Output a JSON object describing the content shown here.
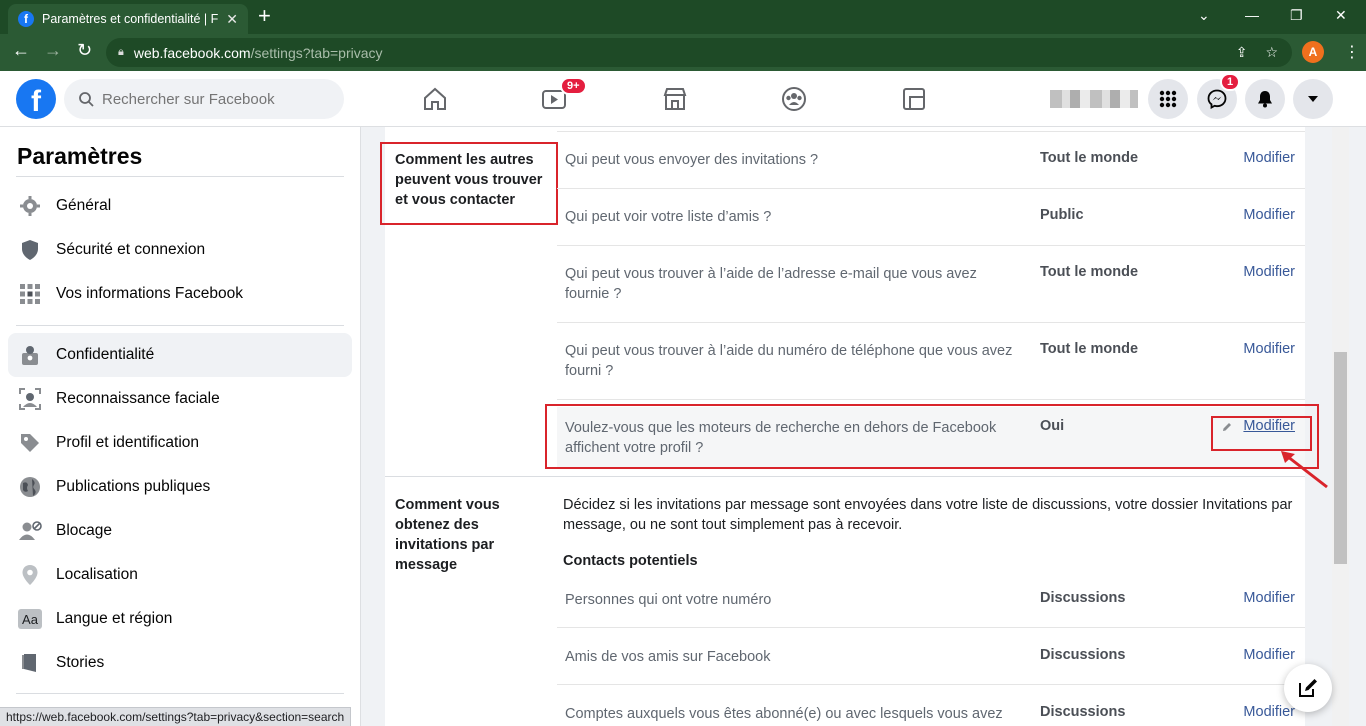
{
  "browser": {
    "tab_title": "Paramètres et confidentialité | Fa",
    "url_host": "web.facebook.com",
    "url_path": "/settings?tab=privacy",
    "profile_initial": "A",
    "status_url": "https://web.facebook.com/settings?tab=privacy&section=search"
  },
  "fb": {
    "logo": "f",
    "search_placeholder": "Rechercher sur Facebook",
    "watch_badge": "9+",
    "messenger_badge": "1"
  },
  "sidebar": {
    "title": "Paramètres",
    "items": [
      {
        "label": "Général",
        "icon": "gear-icon"
      },
      {
        "label": "Sécurité et connexion",
        "icon": "shield-icon"
      },
      {
        "label": "Vos informations Facebook",
        "icon": "grid-icon"
      },
      {
        "label": "Confidentialité",
        "icon": "lock-person-icon",
        "active": true
      },
      {
        "label": "Reconnaissance faciale",
        "icon": "face-icon"
      },
      {
        "label": "Profil et identification",
        "icon": "tag-icon"
      },
      {
        "label": "Publications publiques",
        "icon": "globe-icon"
      },
      {
        "label": "Blocage",
        "icon": "block-user-icon"
      },
      {
        "label": "Localisation",
        "icon": "location-icon"
      },
      {
        "label": "Langue et région",
        "icon": "language-icon"
      },
      {
        "label": "Stories",
        "icon": "stories-icon"
      }
    ]
  },
  "section1": {
    "label_lines": [
      "Comment les autres",
      "peuvent vous trouver",
      "et vous contacter"
    ],
    "rows": [
      {
        "question": "Qui peut vous envoyer des invitations ?",
        "value": "Tout le monde",
        "action": "Modifier"
      },
      {
        "question": "Qui peut voir votre liste d’amis ?",
        "value": "Public",
        "action": "Modifier"
      },
      {
        "question": "Qui peut vous trouver à l’aide de l’adresse e-mail que vous avez fournie ?",
        "value": "Tout le monde",
        "action": "Modifier"
      },
      {
        "question": "Qui peut vous trouver à l’aide du numéro de téléphone que vous avez fourni ?",
        "value": "Tout le monde",
        "action": "Modifier"
      },
      {
        "question": "Voulez-vous que les moteurs de recherche en dehors de Facebook affichent votre profil ?",
        "value": "Oui",
        "action": "Modifier"
      }
    ]
  },
  "section2": {
    "label_lines": [
      "Comment vous",
      "obtenez des",
      "invitations par",
      "message"
    ],
    "description": "Décidez si les invitations par message sont envoyées dans votre liste de discussions, votre dossier Invitations par message, ou ne sont tout simplement pas à recevoir.",
    "subheading": "Contacts potentiels",
    "rows": [
      {
        "question": "Personnes qui ont votre numéro",
        "value": "Discussions",
        "action": "Modifier"
      },
      {
        "question": "Amis de vos amis sur Facebook",
        "value": "Discussions",
        "action": "Modifier"
      },
      {
        "question": "Comptes auxquels vous êtes abonné(e) ou avec lesquels vous avez",
        "value": "Discussions",
        "action": "Modifier"
      }
    ]
  },
  "colors": {
    "annotation_red": "#d9242b",
    "fb_blue": "#1877f2",
    "link_blue": "#385898"
  }
}
